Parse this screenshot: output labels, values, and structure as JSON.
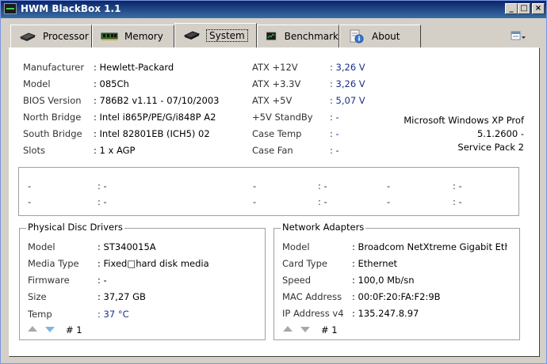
{
  "window": {
    "title": "HWM BlackBox 1.1"
  },
  "tabs": [
    {
      "label": "Processor"
    },
    {
      "label": "Memory"
    },
    {
      "label": "System"
    },
    {
      "label": "Benchmark"
    },
    {
      "label": "About"
    }
  ],
  "system": {
    "left": [
      {
        "label": "Manufacturer",
        "value": ": Hewlett-Packard"
      },
      {
        "label": "Model",
        "value": ": 085Ch"
      },
      {
        "label": "BIOS Version",
        "value": ": 786B2 v1.11 - 07/10/2003"
      },
      {
        "label": "North Bridge",
        "value": ": Intel i865P/PE/G/i848P A2"
      },
      {
        "label": "South Bridge",
        "value": ": Intel 82801EB (ICH5) 02"
      },
      {
        "label": "Slots",
        "value": ": 1 x AGP"
      }
    ],
    "right": [
      {
        "label": "ATX +12V",
        "value": ": 3,26 V"
      },
      {
        "label": "ATX +3.3V",
        "value": ": 3,26 V"
      },
      {
        "label": "ATX +5V",
        "value": ": 5,07 V"
      },
      {
        "label": "+5V StandBy",
        "value": ": -"
      },
      {
        "label": "Case Temp",
        "value": ": -"
      },
      {
        "label": "Case Fan",
        "value": ": -"
      }
    ],
    "os": {
      "name": "Microsoft Windows XP Prof",
      "version": "5.1.2600 -",
      "sp": "Service Pack 2"
    }
  },
  "sensors": {
    "dash": "-",
    "sep": ": -"
  },
  "disc": {
    "title": "Physical Disc Drivers",
    "rows": [
      {
        "label": "Model",
        "value": ": ST340015A"
      },
      {
        "label": "Media Type",
        "value": ": Fixed□hard disk media"
      },
      {
        "label": "Firmware",
        "value": ": -"
      },
      {
        "label": "Size",
        "value": ": 37,27 GB"
      },
      {
        "label": "Temp",
        "value": ": 37 °C"
      }
    ],
    "index": "# 1"
  },
  "network": {
    "title": "Network Adapters",
    "rows": [
      {
        "label": "Model",
        "value": ": Broadcom NetXtreme Gigabit Ether"
      },
      {
        "label": "Card Type",
        "value": ": Ethernet"
      },
      {
        "label": "Speed",
        "value": ": 100,0 Mb/sn"
      },
      {
        "label": "MAC Address",
        "value": ": 00:0F:20:FA:F2:9B"
      },
      {
        "label": "IP Address v4",
        "value": ": 135.247.8.97"
      }
    ],
    "index": "# 1"
  }
}
